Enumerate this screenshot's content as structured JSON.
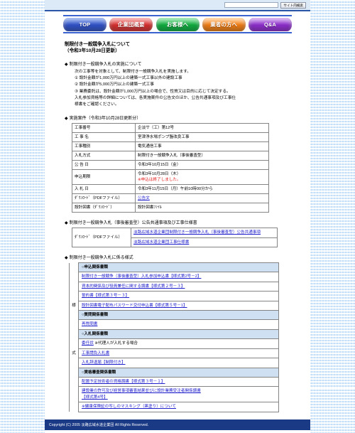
{
  "search": {
    "value": "",
    "placeholder": "",
    "button_label": "サイト内検索"
  },
  "nav": {
    "items": [
      {
        "label": "TOP",
        "color": "#2f4fc4"
      },
      {
        "label": "企業団概要",
        "color": "#d42b2b"
      },
      {
        "label": "お客様へ",
        "color": "#0ea83c"
      },
      {
        "label": "業者の方へ",
        "color": "#ef7a12"
      },
      {
        "label": "Q&A",
        "color": "#8a2bc9"
      }
    ]
  },
  "page": {
    "title_line1": "制限付き一般競争入札について",
    "title_line2": "（令和3年10月28日更新）"
  },
  "section_jisshi": {
    "heading": "制限付き一般競争入札の実施について",
    "lead": "次の工事等を対象として、制限付き一般競争入札を実施します。",
    "item1": "① 設計金額が1,000万円以上の建築一式工事以外の建設工事",
    "item2": "② 設計金額が5,000万円以上の建築一式工事",
    "item3": "③ 業務委託は、設計金額が1,000万円以上の場合で、性質又は目的に応じて決定する。",
    "note1": "入札参加資格等の詳細については、各実施案件の公告文のほか、公告共通事項及び工事仕",
    "note2": "様書をご確認ください。"
  },
  "section_anken": {
    "heading": "実施案件（令和3年10月28日更新分）",
    "rows": [
      {
        "key": "工事番号",
        "value": "企淡サ（工）第12号"
      },
      {
        "key": "工 事 名",
        "value": "室津浄水場ポンプ盤改良工事"
      },
      {
        "key": "工事種別",
        "value": "電気通信工事"
      },
      {
        "key": "入札方式",
        "value": "制限付き一般競争入札（事後審査型）"
      },
      {
        "key": "公 告 日",
        "value": "令和3年10月15日（金）"
      },
      {
        "key": "申込期限",
        "value": "令和3年10月28日（木）",
        "warn": "※申込は終了しました。"
      },
      {
        "key": "入 札 日",
        "value": "令和3年11月15日（月）午前10時00分から"
      },
      {
        "key": "ﾀﾞｳﾝﾛｰﾄﾞ（PDFファイル）",
        "link": "公告文"
      },
      {
        "key": "設計図書（ﾀﾞｳﾝﾛｰﾄﾞ）",
        "value": "設計図書ﾌｧｲﾙ"
      }
    ]
  },
  "section_kyotsu": {
    "heading": "制限付き一般競争入札（事後審査型）公告共通事項及び工事仕様書",
    "key": "ﾀﾞｳﾝﾛｰﾄﾞ（PDFファイル）",
    "links": [
      "淡路広域水道企業団制限付き一般競争入札（事後審査型）公告共通事項",
      "淡路広域水道企業団工事仕様書"
    ]
  },
  "section_yoshiki": {
    "heading": "制限付き一般競争入札に係る様式",
    "vertical_label_1": "様",
    "vertical_label_2": "式",
    "rows": [
      {
        "type": "group",
        "label": "○申込関係書類"
      },
      {
        "type": "link",
        "label": "制限付き一般競争（事後審査型）入札参加申込書【様式第2号－2】"
      },
      {
        "type": "link",
        "label": "資本的関係及び役員兼任に関する調書【様式第２号－３】"
      },
      {
        "type": "link",
        "label": "誓約書【様式第３号－３】"
      },
      {
        "type": "link",
        "label": "設計図書電子配布パスワード交付申込書【様式第５号－1】"
      },
      {
        "type": "group",
        "label": "○質問関係書類"
      },
      {
        "type": "link",
        "label": "再質問書"
      },
      {
        "type": "group",
        "label": "○入札関係書類"
      },
      {
        "type": "link",
        "label": "委任状",
        "suffix": "※代理人が入札する場合"
      },
      {
        "type": "link",
        "label": "工事請負入札書"
      },
      {
        "type": "link",
        "label": "入札辞退届【制限付き】"
      },
      {
        "type": "group",
        "label": "○資格審査関係書類"
      },
      {
        "type": "link",
        "label": "配置予定技術者の資格調書【様式第３号－１】"
      },
      {
        "type": "link",
        "label": "建設業の許可及び経営事項審査結果並びに設計業務受注者関係調書\n【様式第4号】"
      },
      {
        "type": "link",
        "label": "※健康保険証の写しのマスキング（黒塗り）について"
      }
    ]
  },
  "footer": {
    "text": "Copyright (C) 2005 淡路広域水道企業団 All Rights Reserved."
  }
}
